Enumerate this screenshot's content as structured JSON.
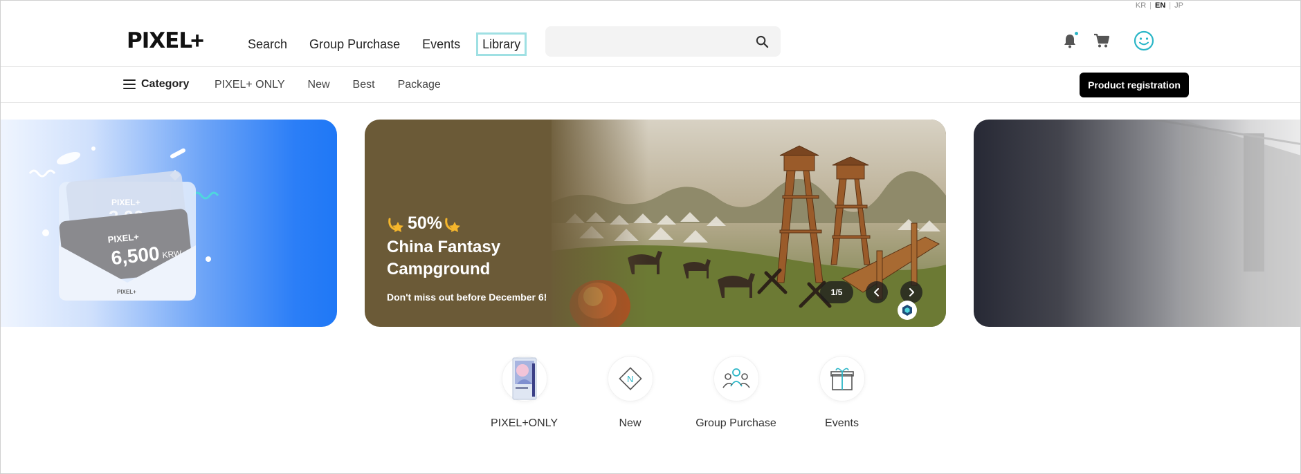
{
  "lang": {
    "items": [
      "KR",
      "EN",
      "JP"
    ],
    "active": "EN"
  },
  "header": {
    "logo_text": "PIXEL",
    "logo_plus": "+",
    "nav": [
      "Search",
      "Group Purchase",
      "Events",
      "Library"
    ],
    "search_placeholder": "",
    "icons": [
      "bell-icon",
      "cart-icon",
      "smiley-face-icon"
    ]
  },
  "subnav": {
    "category_label": "Category",
    "links": [
      "PIXEL+ ONLY",
      "New",
      "Best",
      "Package"
    ],
    "product_registration": "Product registration"
  },
  "carousel": {
    "active_slide": {
      "badge_value": "50%",
      "title": "China Fantasy Campground",
      "subtitle": "Don't miss out before December 6!"
    },
    "counter": "1/5",
    "left_slide": {
      "ticket_brand": "PIXEL+",
      "ticket_value_back": "3,00",
      "ticket_value": "6,500",
      "ticket_currency": "KRW",
      "envelope_brand": "PIXEL+"
    }
  },
  "quick_menu": [
    {
      "label": "PIXEL+ONLY",
      "icon": "product-box-icon"
    },
    {
      "label": "New",
      "icon": "new-badge-icon"
    },
    {
      "label": "Group Purchase",
      "icon": "group-people-icon"
    },
    {
      "label": "Events",
      "icon": "gift-box-icon"
    }
  ],
  "colors": {
    "accent": "#2bb6c7",
    "button": "#000000",
    "banner_brown": "#6b5a37",
    "banner_blue": "#1f78f6"
  }
}
